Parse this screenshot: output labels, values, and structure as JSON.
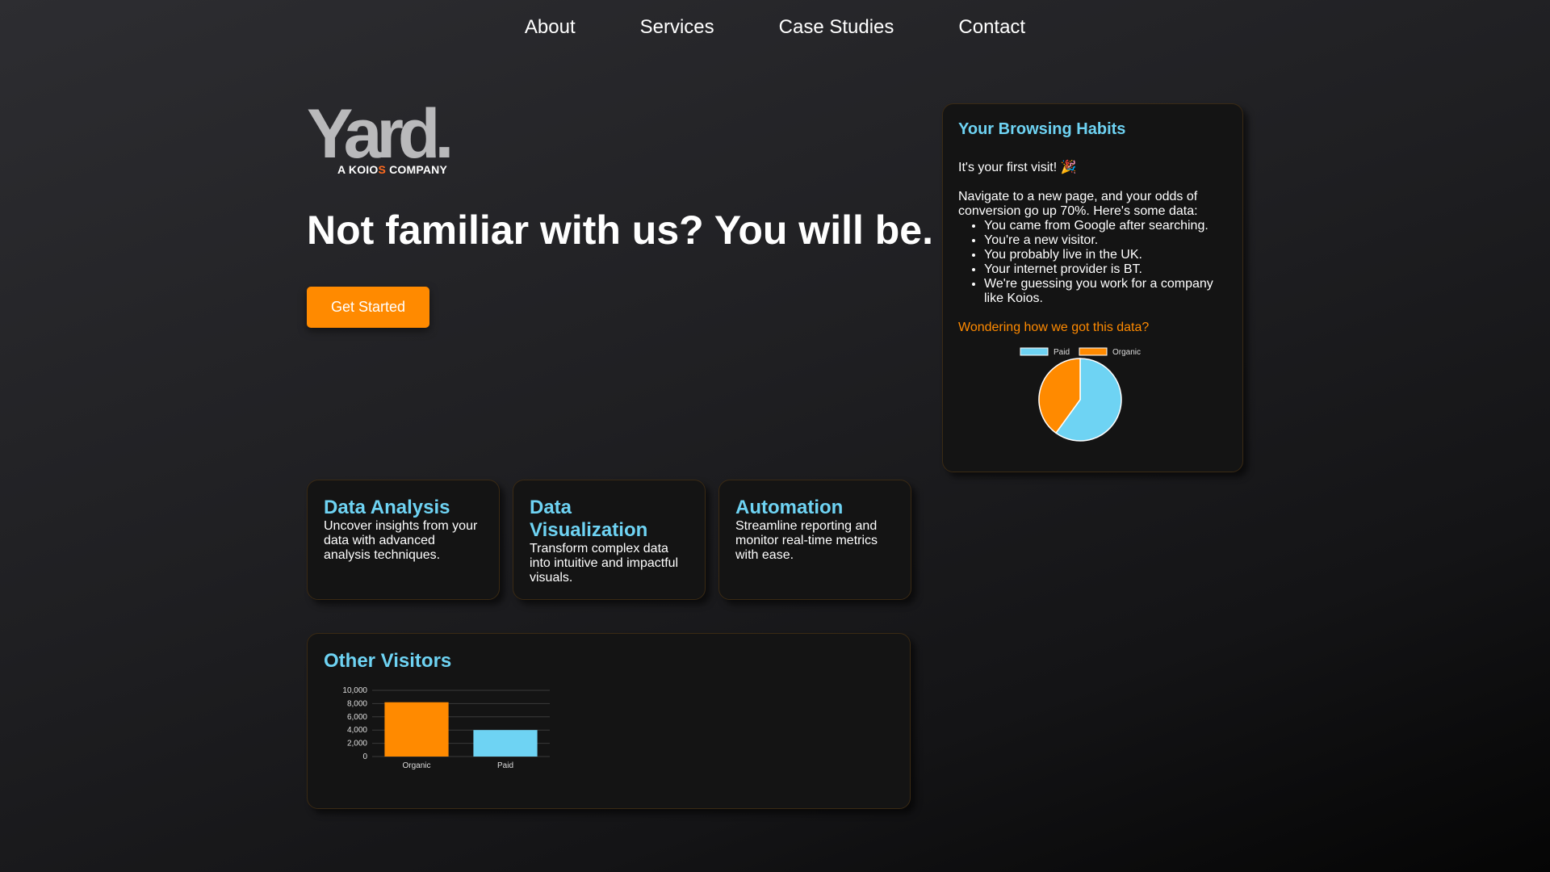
{
  "nav": {
    "items": [
      "About",
      "Services",
      "Case Studies",
      "Contact"
    ]
  },
  "logo": {
    "wordmark": "Yard.",
    "tagline_pre": "A KOIO",
    "tagline_accent": "S",
    "tagline_post": " COMPANY"
  },
  "hero": {
    "headline": "Not familiar with us? You will be.",
    "cta_label": "Get Started"
  },
  "services": [
    {
      "title": "Data Analysis",
      "text": "Uncover insights from your data with advanced analysis techniques."
    },
    {
      "title": "Data Visualization",
      "text": "Transform complex data into intuitive and impactful visuals."
    },
    {
      "title": "Automation",
      "text": "Streamline reporting and monitor real-time metrics with ease."
    }
  ],
  "habits": {
    "title": "Your Browsing Habits",
    "first_visit": "It's your first visit! 🎉",
    "intro": "Navigate to a new page, and your odds of conversion go up 70%. Here's some data:",
    "items": [
      "You came from Google after searching.",
      "You're a new visitor.",
      "You probably live in the UK.",
      "Your internet provider is BT.",
      "We're guessing you work for a company like Koios."
    ],
    "link": "Wondering how we got this data?"
  },
  "visitors": {
    "title": "Other Visitors"
  },
  "colors": {
    "accent_blue": "#6ed3f3",
    "accent_orange": "#ff8a00"
  },
  "chart_data": [
    {
      "type": "pie",
      "legend_position": "top",
      "series": [
        {
          "name": "Paid",
          "value": 60,
          "color": "#6ed3f3"
        },
        {
          "name": "Organic",
          "value": 40,
          "color": "#ff8a00"
        }
      ]
    },
    {
      "type": "bar",
      "categories": [
        "Organic",
        "Paid"
      ],
      "values": [
        8200,
        4000
      ],
      "colors": [
        "#ff8a00",
        "#6ed3f3"
      ],
      "ylim": [
        0,
        10000
      ],
      "yticks": [
        0,
        2000,
        4000,
        6000,
        8000,
        10000
      ],
      "ytick_labels": [
        "0",
        "2,000",
        "4,000",
        "6,000",
        "8,000",
        "10,000"
      ],
      "grid": true
    }
  ]
}
